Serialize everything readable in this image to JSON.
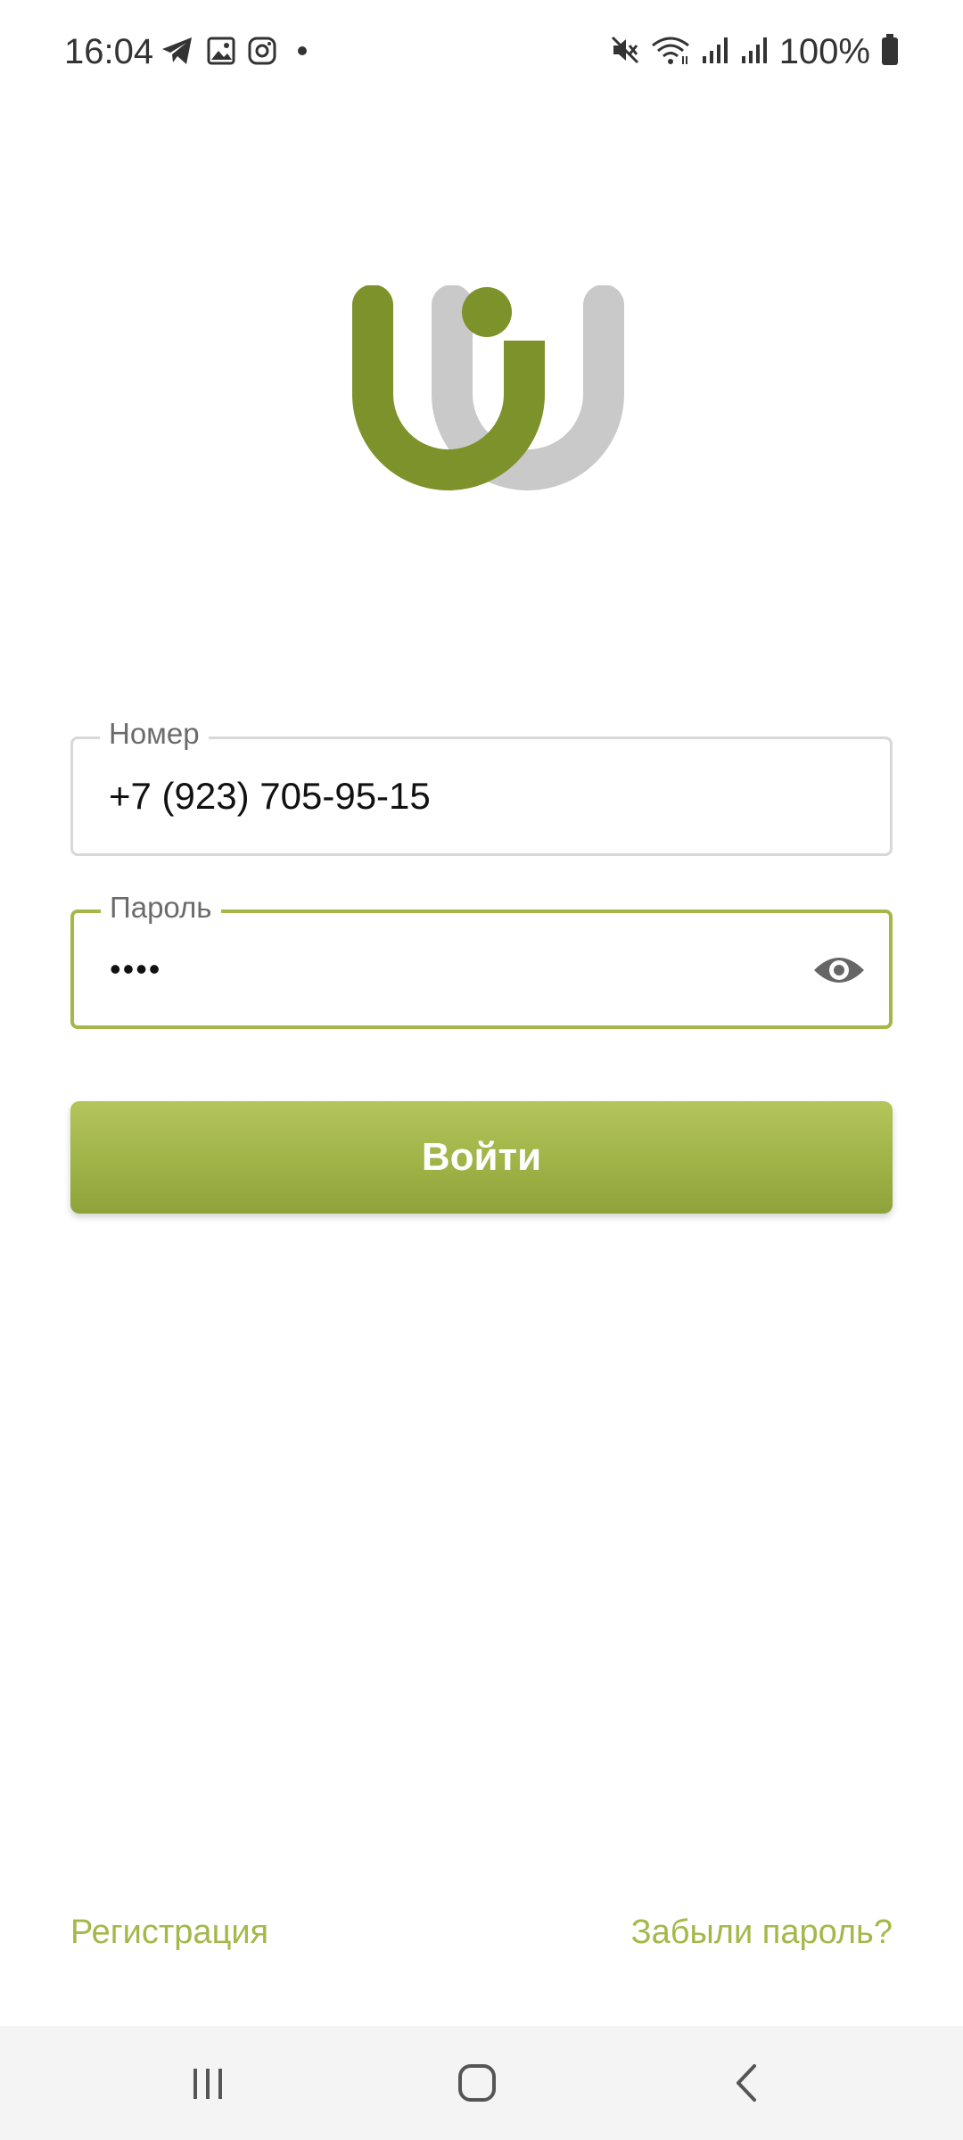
{
  "status_bar": {
    "time": "16:04",
    "notification_icons": [
      "telegram-icon",
      "gallery-icon",
      "instagram-icon",
      "more-notifications-dot"
    ],
    "system_icons": [
      "mute-icon",
      "wifi-icon",
      "signal-icon",
      "signal-icon-2"
    ],
    "battery_text": "100%"
  },
  "colors": {
    "brand_green": "#7d922a",
    "accent_green": "#a4b84a",
    "logo_gray": "#c9c9c9"
  },
  "form": {
    "phone": {
      "label": "Номер",
      "value": "+7 (923) 705-95-15"
    },
    "password": {
      "label": "Пароль",
      "value": "••••",
      "toggle_icon": "eye-icon"
    },
    "login_button": "Войти"
  },
  "links": {
    "register": "Регистрация",
    "forgot_password": "Забыли пароль?"
  },
  "nav_bar": {
    "buttons": [
      "recent-apps-icon",
      "home-icon",
      "back-icon"
    ]
  }
}
